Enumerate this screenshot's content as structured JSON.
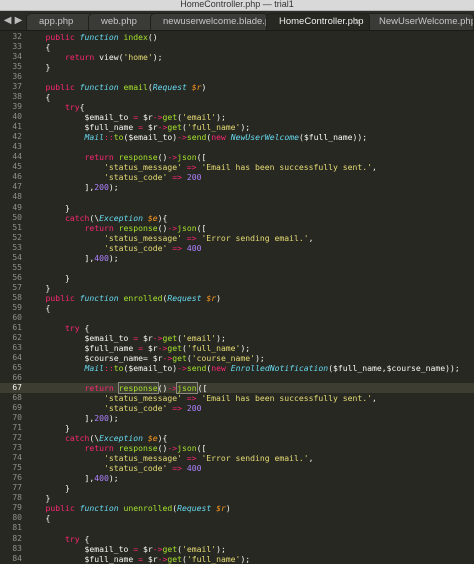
{
  "window": {
    "title": "HomeController.php — trial1"
  },
  "tabs": [
    {
      "label": "app.php"
    },
    {
      "label": "web.php"
    },
    {
      "label": "newuserwelcome.blade.php"
    },
    {
      "label": "HomeController.php"
    },
    {
      "label": "NewUserWelcome.php"
    }
  ],
  "active_tab": 3,
  "cursor_line": 67,
  "colors": {
    "background": "#272822",
    "keyword": "#f92672",
    "string": "#e6db74",
    "storage": "#66d9ef",
    "function": "#a6e22e",
    "number": "#ae81ff",
    "variable": "#fd971f"
  },
  "lines": [
    {
      "n": "32",
      "t": [
        [
          "    ",
          "p"
        ],
        [
          "public ",
          "k"
        ],
        [
          "function ",
          "f"
        ],
        [
          "index",
          "fn"
        ],
        [
          "()",
          "p"
        ]
      ]
    },
    {
      "n": "33",
      "t": [
        [
          "    {",
          "p"
        ]
      ]
    },
    {
      "n": "34",
      "t": [
        [
          "        ",
          "p"
        ],
        [
          "return ",
          "k"
        ],
        [
          "view",
          "p"
        ],
        [
          "(",
          "p"
        ],
        [
          "'home'",
          "s"
        ],
        [
          ");",
          "p"
        ]
      ]
    },
    {
      "n": "35",
      "t": [
        [
          "    }",
          "p"
        ]
      ]
    },
    {
      "n": "36",
      "t": []
    },
    {
      "n": "37",
      "t": [
        [
          "    ",
          "p"
        ],
        [
          "public ",
          "k"
        ],
        [
          "function ",
          "f"
        ],
        [
          "email",
          "fn"
        ],
        [
          "(",
          "p"
        ],
        [
          "Request ",
          "f"
        ],
        [
          "$r",
          "v"
        ],
        [
          ")",
          "p"
        ]
      ]
    },
    {
      "n": "38",
      "t": [
        [
          "    {",
          "p"
        ]
      ]
    },
    {
      "n": "39",
      "t": [
        [
          "        ",
          "p"
        ],
        [
          "try",
          "k"
        ],
        [
          "{",
          "p"
        ]
      ]
    },
    {
      "n": "40",
      "t": [
        [
          "            $email_to ",
          "p"
        ],
        [
          "= ",
          "k"
        ],
        [
          "$r",
          "p"
        ],
        [
          "->",
          "k"
        ],
        [
          "get",
          "fn"
        ],
        [
          "(",
          "p"
        ],
        [
          "'email'",
          "s"
        ],
        [
          ");",
          "p"
        ]
      ]
    },
    {
      "n": "41",
      "t": [
        [
          "            $full_name ",
          "p"
        ],
        [
          "= ",
          "k"
        ],
        [
          "$r",
          "p"
        ],
        [
          "->",
          "k"
        ],
        [
          "get",
          "fn"
        ],
        [
          "(",
          "p"
        ],
        [
          "'full_name'",
          "s"
        ],
        [
          ");",
          "p"
        ]
      ]
    },
    {
      "n": "42",
      "t": [
        [
          "            ",
          "p"
        ],
        [
          "Mail",
          "f"
        ],
        [
          "::",
          "k"
        ],
        [
          "to",
          "fn"
        ],
        [
          "($email_to)",
          "p"
        ],
        [
          "->",
          "k"
        ],
        [
          "send",
          "fn"
        ],
        [
          "(",
          "p"
        ],
        [
          "new ",
          "k"
        ],
        [
          "NewUserWelcome",
          "f"
        ],
        [
          "($full_name));",
          "p"
        ]
      ]
    },
    {
      "n": "43",
      "t": []
    },
    {
      "n": "44",
      "t": [
        [
          "            ",
          "p"
        ],
        [
          "return ",
          "k"
        ],
        [
          "response",
          "fn"
        ],
        [
          "()",
          "p"
        ],
        [
          "->",
          "k"
        ],
        [
          "json",
          "fn"
        ],
        [
          "([",
          "p"
        ]
      ]
    },
    {
      "n": "45",
      "t": [
        [
          "                ",
          "p"
        ],
        [
          "'status_message'",
          "s"
        ],
        [
          " => ",
          "k"
        ],
        [
          "'Email has been successfully sent.'",
          "s"
        ],
        [
          ",",
          "p"
        ]
      ]
    },
    {
      "n": "46",
      "t": [
        [
          "                ",
          "p"
        ],
        [
          "'status_code'",
          "s"
        ],
        [
          " => ",
          "k"
        ],
        [
          "200",
          "c"
        ]
      ]
    },
    {
      "n": "47",
      "t": [
        [
          "            ],",
          "p"
        ],
        [
          "200",
          "c"
        ],
        [
          ");",
          "p"
        ]
      ]
    },
    {
      "n": "48",
      "t": []
    },
    {
      "n": "49",
      "t": [
        [
          "        }",
          "p"
        ]
      ]
    },
    {
      "n": "50",
      "t": [
        [
          "        ",
          "p"
        ],
        [
          "catch",
          "k"
        ],
        [
          "(",
          "p"
        ],
        [
          "\\",
          "p"
        ],
        [
          "Exception ",
          "f"
        ],
        [
          "$e",
          "v"
        ],
        [
          "){",
          "p"
        ]
      ]
    },
    {
      "n": "51",
      "t": [
        [
          "            ",
          "p"
        ],
        [
          "return ",
          "k"
        ],
        [
          "response",
          "fn"
        ],
        [
          "()",
          "p"
        ],
        [
          "->",
          "k"
        ],
        [
          "json",
          "fn"
        ],
        [
          "([",
          "p"
        ]
      ]
    },
    {
      "n": "52",
      "t": [
        [
          "                ",
          "p"
        ],
        [
          "'status_message'",
          "s"
        ],
        [
          " => ",
          "k"
        ],
        [
          "'Error sending email.'",
          "s"
        ],
        [
          ",",
          "p"
        ]
      ]
    },
    {
      "n": "53",
      "t": [
        [
          "                ",
          "p"
        ],
        [
          "'status_code'",
          "s"
        ],
        [
          " => ",
          "k"
        ],
        [
          "400",
          "c"
        ]
      ]
    },
    {
      "n": "54",
      "t": [
        [
          "            ],",
          "p"
        ],
        [
          "400",
          "c"
        ],
        [
          ");",
          "p"
        ]
      ]
    },
    {
      "n": "55",
      "t": []
    },
    {
      "n": "56",
      "t": [
        [
          "        }",
          "p"
        ]
      ]
    },
    {
      "n": "57",
      "t": [
        [
          "    }",
          "p"
        ]
      ]
    },
    {
      "n": "58",
      "t": [
        [
          "    ",
          "p"
        ],
        [
          "public ",
          "k"
        ],
        [
          "function ",
          "f"
        ],
        [
          "enrolled",
          "fn"
        ],
        [
          "(",
          "p"
        ],
        [
          "Request ",
          "f"
        ],
        [
          "$r",
          "v"
        ],
        [
          ")",
          "p"
        ]
      ]
    },
    {
      "n": "59",
      "t": [
        [
          "    {",
          "p"
        ]
      ]
    },
    {
      "n": "60",
      "t": []
    },
    {
      "n": "61",
      "t": [
        [
          "        ",
          "p"
        ],
        [
          "try ",
          "k"
        ],
        [
          "{",
          "p"
        ]
      ]
    },
    {
      "n": "62",
      "t": [
        [
          "            $email_to ",
          "p"
        ],
        [
          "= ",
          "k"
        ],
        [
          "$r",
          "p"
        ],
        [
          "->",
          "k"
        ],
        [
          "get",
          "fn"
        ],
        [
          "(",
          "p"
        ],
        [
          "'email'",
          "s"
        ],
        [
          ");",
          "p"
        ]
      ]
    },
    {
      "n": "63",
      "t": [
        [
          "            $full_name ",
          "p"
        ],
        [
          "= ",
          "k"
        ],
        [
          "$r",
          "p"
        ],
        [
          "->",
          "k"
        ],
        [
          "get",
          "fn"
        ],
        [
          "(",
          "p"
        ],
        [
          "'full_name'",
          "s"
        ],
        [
          ");",
          "p"
        ]
      ]
    },
    {
      "n": "64",
      "t": [
        [
          "            $course_name= ",
          "p"
        ],
        [
          "$r",
          "p"
        ],
        [
          "->",
          "k"
        ],
        [
          "get",
          "fn"
        ],
        [
          "(",
          "p"
        ],
        [
          "'course_name'",
          "s"
        ],
        [
          ");",
          "p"
        ]
      ]
    },
    {
      "n": "65",
      "t": [
        [
          "            ",
          "p"
        ],
        [
          "Mail",
          "f"
        ],
        [
          "::",
          "k"
        ],
        [
          "to",
          "fn"
        ],
        [
          "($email_to)",
          "p"
        ],
        [
          "->",
          "k"
        ],
        [
          "send",
          "fn"
        ],
        [
          "(",
          "p"
        ],
        [
          "new ",
          "k"
        ],
        [
          "EnrolledNotification",
          "f"
        ],
        [
          "($full_name,$course_name));",
          "p"
        ]
      ]
    },
    {
      "n": "66",
      "t": []
    },
    {
      "n": "67",
      "t": [
        [
          "            ",
          "p"
        ],
        [
          "return ",
          "k"
        ],
        [
          "response",
          "fn sel"
        ],
        [
          "()",
          "p"
        ],
        [
          "->",
          "k"
        ],
        [
          "json",
          "fn sel"
        ],
        [
          "|",
          "cursor"
        ],
        [
          "([",
          "p"
        ]
      ]
    },
    {
      "n": "68",
      "t": [
        [
          "                ",
          "p"
        ],
        [
          "'status_message'",
          "s"
        ],
        [
          " => ",
          "k"
        ],
        [
          "'Email has been successfully sent.'",
          "s"
        ],
        [
          ",",
          "p"
        ]
      ]
    },
    {
      "n": "69",
      "t": [
        [
          "                ",
          "p"
        ],
        [
          "'status_code'",
          "s"
        ],
        [
          " => ",
          "k"
        ],
        [
          "200",
          "c"
        ]
      ]
    },
    {
      "n": "70",
      "t": [
        [
          "            ],",
          "p"
        ],
        [
          "200",
          "c"
        ],
        [
          ");",
          "p"
        ]
      ]
    },
    {
      "n": "71",
      "t": [
        [
          "        }",
          "p"
        ]
      ]
    },
    {
      "n": "72",
      "t": [
        [
          "        ",
          "p"
        ],
        [
          "catch",
          "k"
        ],
        [
          "(",
          "p"
        ],
        [
          "\\",
          "p"
        ],
        [
          "Exception ",
          "f"
        ],
        [
          "$e",
          "v"
        ],
        [
          "){",
          "p"
        ]
      ]
    },
    {
      "n": "73",
      "t": [
        [
          "            ",
          "p"
        ],
        [
          "return ",
          "k"
        ],
        [
          "response",
          "fn"
        ],
        [
          "()",
          "p"
        ],
        [
          "->",
          "k"
        ],
        [
          "json",
          "fn"
        ],
        [
          "([",
          "p"
        ]
      ]
    },
    {
      "n": "74",
      "t": [
        [
          "                ",
          "p"
        ],
        [
          "'status_message'",
          "s"
        ],
        [
          " => ",
          "k"
        ],
        [
          "'Error sending email.'",
          "s"
        ],
        [
          ",",
          "p"
        ]
      ]
    },
    {
      "n": "75",
      "t": [
        [
          "                ",
          "p"
        ],
        [
          "'status_code'",
          "s"
        ],
        [
          " => ",
          "k"
        ],
        [
          "400",
          "c"
        ]
      ]
    },
    {
      "n": "76",
      "t": [
        [
          "            ],",
          "p"
        ],
        [
          "400",
          "c"
        ],
        [
          ");",
          "p"
        ]
      ]
    },
    {
      "n": "77",
      "t": [
        [
          "        }",
          "p"
        ]
      ]
    },
    {
      "n": "78",
      "t": [
        [
          "    }",
          "p"
        ]
      ]
    },
    {
      "n": "79",
      "t": [
        [
          "    ",
          "p"
        ],
        [
          "public ",
          "k"
        ],
        [
          "function ",
          "f"
        ],
        [
          "unenrolled",
          "fn"
        ],
        [
          "(",
          "p"
        ],
        [
          "Request ",
          "f"
        ],
        [
          "$r",
          "v"
        ],
        [
          ")",
          "p"
        ]
      ]
    },
    {
      "n": "80",
      "t": [
        [
          "    {",
          "p"
        ]
      ]
    },
    {
      "n": "81",
      "t": []
    },
    {
      "n": "82",
      "t": [
        [
          "        ",
          "p"
        ],
        [
          "try ",
          "k"
        ],
        [
          "{",
          "p"
        ]
      ]
    },
    {
      "n": "83",
      "t": [
        [
          "            $email_to ",
          "p"
        ],
        [
          "= ",
          "k"
        ],
        [
          "$r",
          "p"
        ],
        [
          "->",
          "k"
        ],
        [
          "get",
          "fn"
        ],
        [
          "(",
          "p"
        ],
        [
          "'email'",
          "s"
        ],
        [
          ");",
          "p"
        ]
      ]
    },
    {
      "n": "84",
      "t": [
        [
          "            $full_name ",
          "p"
        ],
        [
          "= ",
          "k"
        ],
        [
          "$r",
          "p"
        ],
        [
          "->",
          "k"
        ],
        [
          "get",
          "fn"
        ],
        [
          "(",
          "p"
        ],
        [
          "'full_name'",
          "s"
        ],
        [
          ");",
          "p"
        ]
      ]
    }
  ]
}
